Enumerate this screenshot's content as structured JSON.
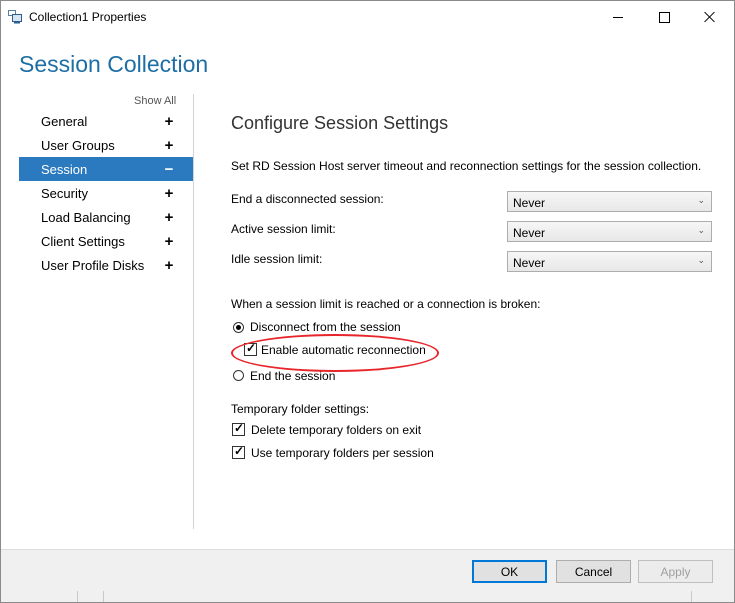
{
  "window": {
    "title": "Collection1 Properties",
    "app_icon": "collection-properties-icon",
    "controls": {
      "minimize": "minimize-icon",
      "maximize": "maximize-icon",
      "close": "close-icon"
    }
  },
  "header": {
    "title": "Session Collection"
  },
  "nav": {
    "show_all": "Show All",
    "items": [
      {
        "label": "General",
        "expander": "+"
      },
      {
        "label": "User Groups",
        "expander": "+"
      },
      {
        "label": "Session",
        "expander": "−",
        "selected": true
      },
      {
        "label": "Security",
        "expander": "+"
      },
      {
        "label": "Load Balancing",
        "expander": "+"
      },
      {
        "label": "Client Settings",
        "expander": "+"
      },
      {
        "label": "User Profile Disks",
        "expander": "+"
      }
    ]
  },
  "main": {
    "title": "Configure Session Settings",
    "description": "Set RD Session Host server timeout and reconnection settings for the session collection.",
    "settings": [
      {
        "label": "End a disconnected session:",
        "value": "Never"
      },
      {
        "label": "Active session limit:",
        "value": "Never"
      },
      {
        "label": "Idle session limit:",
        "value": "Never"
      }
    ],
    "limit_group": {
      "label": "When a session limit is reached or a connection is broken:",
      "disconnect": {
        "label": "Disconnect from the session",
        "selected": true
      },
      "auto_reconnect": {
        "label": "Enable automatic reconnection",
        "checked": true
      },
      "end_session": {
        "label": "End the session",
        "selected": false
      }
    },
    "temp_group": {
      "label": "Temporary folder settings:",
      "delete_on_exit": {
        "label": "Delete temporary folders on exit",
        "checked": true
      },
      "per_session": {
        "label": "Use temporary folders per session",
        "checked": true
      }
    },
    "highlight_color": "#e8252a"
  },
  "footer": {
    "ok": "OK",
    "cancel": "Cancel",
    "apply": "Apply"
  },
  "colors": {
    "accent": "#1e6ea6",
    "selection": "#2b79bf"
  }
}
